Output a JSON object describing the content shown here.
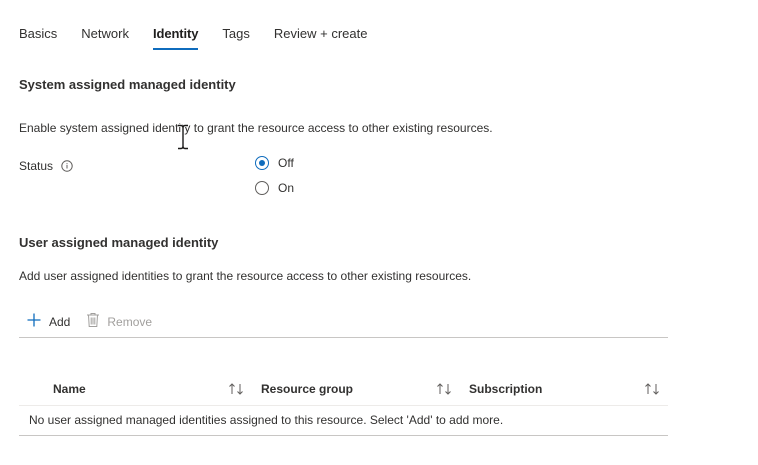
{
  "tabs": [
    {
      "label": "Basics",
      "active": false
    },
    {
      "label": "Network",
      "active": false
    },
    {
      "label": "Identity",
      "active": true
    },
    {
      "label": "Tags",
      "active": false
    },
    {
      "label": "Review + create",
      "active": false
    }
  ],
  "system": {
    "heading": "System assigned managed identity",
    "description": "Enable system assigned identity to grant the resource access to other existing resources.",
    "status_label": "Status",
    "options": [
      {
        "label": "Off",
        "checked": true
      },
      {
        "label": "On",
        "checked": false
      }
    ]
  },
  "user": {
    "heading": "User assigned managed identity",
    "description": "Add user assigned identities to grant the resource access to other existing resources.",
    "toolbar": {
      "add_label": "Add",
      "remove_label": "Remove"
    },
    "table": {
      "columns": [
        "Name",
        "Resource group",
        "Subscription"
      ],
      "empty_message": "No user assigned managed identities assigned to this resource. Select 'Add' to add more."
    }
  },
  "colors": {
    "accent": "#0f6cbd",
    "text": "#323130",
    "disabled": "#a19f9d"
  },
  "icons": [
    "info-icon",
    "add-icon",
    "trash-icon",
    "sort-icon",
    "text-cursor-icon"
  ]
}
